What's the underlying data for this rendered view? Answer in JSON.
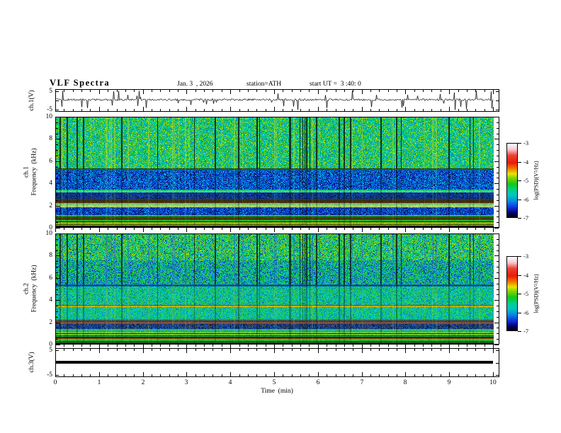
{
  "window": {
    "bg": "#ffffff",
    "fg": "#000000"
  },
  "header": {
    "title": "VLF Spectra",
    "date": "Jan. 3  , 2026",
    "station": "station=ATH",
    "start_ut": "start UT =  3 :40: 0"
  },
  "axes": {
    "time": {
      "label": "Time  (min)",
      "min": 0,
      "max": 10,
      "major_tick_labels": [
        "0",
        "1",
        "2",
        "3",
        "4",
        "5",
        "6",
        "7",
        "8",
        "9",
        "10"
      ],
      "minor_step_min": 0.2
    },
    "frequency": {
      "tick_labels": [
        "0",
        "2",
        "4",
        "6",
        "8",
        "10"
      ],
      "tick_values": [
        0,
        2,
        4,
        6,
        8,
        10
      ],
      "minor_step_khz": 0.5,
      "unit": "kHz"
    },
    "voltage": {
      "tick_labels": [
        "5",
        "-5"
      ],
      "tick_values": [
        5,
        -5
      ],
      "unit": "V"
    }
  },
  "panels": [
    {
      "id": "ch1_wave",
      "ylabel": "ch.1(V)",
      "ymin": -5,
      "ymax": 5
    },
    {
      "id": "ch1_spec",
      "ylabel_l1": "ch.1",
      "ylabel_l2": "Frequency  (kHz)",
      "ymin": 0,
      "ymax": 10
    },
    {
      "id": "ch2_spec",
      "ylabel_l1": "ch.2",
      "ylabel_l2": "Frequency  (kHz)",
      "ymin": 0,
      "ymax": 10
    },
    {
      "id": "ch3_wave",
      "ylabel": "ch.3(V)",
      "ymin": -5,
      "ymax": 5
    }
  ],
  "colorbar": {
    "label": "log(PSD)(V²/Hz)",
    "tick_labels": [
      "-3",
      "-4",
      "-5",
      "-6",
      "-7"
    ],
    "zmax": -3,
    "zmin": -7,
    "gradient": [
      [
        "#ffffff",
        0
      ],
      [
        "#f6c6d2",
        8
      ],
      [
        "#ee4030",
        16
      ],
      [
        "#e81a0c",
        26
      ],
      [
        "#f07800",
        34
      ],
      [
        "#e8e400",
        41
      ],
      [
        "#7cd400",
        47
      ],
      [
        "#12c818",
        55
      ],
      [
        "#00d088",
        63
      ],
      [
        "#00c4c4",
        70
      ],
      [
        "#0090e0",
        78
      ],
      [
        "#1238e0",
        86
      ],
      [
        "#000078",
        94
      ],
      [
        "#000000",
        100
      ]
    ]
  },
  "render": {
    "seed": 20260103,
    "streaks": {
      "dark_fraction": 0.045,
      "bright_fraction": 0.05
    }
  },
  "chart_data": [
    {
      "type": "line",
      "name": "ch.1 voltage waveform",
      "xlim": [
        0,
        10
      ],
      "xlabel": "Time (min)",
      "ylim": [
        -5,
        5
      ],
      "ylabel": "ch.1(V)",
      "summary": {
        "baseline_v": 0.4,
        "noise_peak_to_peak_v": 1.0,
        "impulsive_spikes": {
          "approx_count": 45,
          "amplitude_v_range": [
            1.5,
            5
          ],
          "polarity": "both, mostly negative",
          "clipped_at": 5
        }
      }
    },
    {
      "type": "heatmap",
      "name": "ch.1 spectrogram",
      "xlim": [
        0,
        10
      ],
      "xlabel": "Time (min)",
      "ylim": [
        0,
        10
      ],
      "ylabel": "ch.1 Frequency (kHz)",
      "zlim": [
        -7,
        -3
      ],
      "zlabel": "log(PSD)(V²/Hz)",
      "vertical_streaks": "full-band impulsive streaks aligned with ch.1 spikes (dark and bright columns)",
      "bands": [
        {
          "f0": 0.0,
          "f1": 0.12,
          "log_psd": -7.0,
          "mode": "rows",
          "streak": 0.0,
          "palette": [
            [
              "#000006",
              1
            ]
          ]
        },
        {
          "f0": 0.12,
          "f1": 0.5,
          "log_psd": -4.9,
          "mode": "rows",
          "streak": 0.2,
          "palette": [
            [
              "#14b83c",
              3
            ],
            [
              "#b4d400",
              2
            ],
            [
              "#06280a",
              2
            ]
          ]
        },
        {
          "f0": 0.5,
          "f1": 0.72,
          "log_psd": -4.4,
          "mode": "rows",
          "streak": 0.2,
          "palette": [
            [
              "#9a3410",
              2
            ],
            [
              "#18b838",
              2
            ],
            [
              "#0a340a",
              1
            ]
          ]
        },
        {
          "f0": 0.72,
          "f1": 0.95,
          "log_psd": -4.2,
          "mode": "rows",
          "streak": 0.2,
          "palette": [
            [
              "#742608",
              3
            ],
            [
              "#526014",
              1
            ],
            [
              "#1c340a",
              2
            ]
          ]
        },
        {
          "f0": 0.95,
          "f1": 1.12,
          "log_psd": -5.0,
          "mode": "rows",
          "streak": 0.2,
          "palette": [
            [
              "#22c44c",
              2
            ],
            [
              "#8ccc24",
              1
            ]
          ]
        },
        {
          "f0": 1.12,
          "f1": 1.8,
          "log_psd": -6.4,
          "mode": "speckle",
          "streak": 0.5,
          "bright": "#30c8d8",
          "palette": [
            [
              "#0f32c4",
              5
            ],
            [
              "#0864dc",
              3
            ],
            [
              "#00acd4",
              1
            ],
            [
              "#061048",
              2
            ]
          ]
        },
        {
          "f0": 1.8,
          "f1": 2.2,
          "log_psd": -4.8,
          "mode": "rows",
          "streak": 0.25,
          "palette": [
            [
              "#9cc860",
              2
            ],
            [
              "#c4d890",
              1
            ],
            [
              "#2cb84c",
              2
            ]
          ]
        },
        {
          "f0": 2.2,
          "f1": 2.6,
          "log_psd": -4.3,
          "mode": "rows",
          "streak": 0.25,
          "palette": [
            [
              "#6e2410",
              3
            ],
            [
              "#3a3420",
              2
            ],
            [
              "#0e3c12",
              1
            ]
          ]
        },
        {
          "f0": 2.6,
          "f1": 3.15,
          "log_psd": -6.5,
          "mode": "speckle",
          "streak": 0.4,
          "bright": "#30c8d8",
          "palette": [
            [
              "#26365a",
              2
            ],
            [
              "#0f2ca8",
              3
            ],
            [
              "#0854bc",
              2
            ],
            [
              "#061c3c",
              2
            ]
          ]
        },
        {
          "f0": 3.15,
          "f1": 3.4,
          "log_psd": -5.4,
          "mode": "rows",
          "streak": 0.3,
          "palette": [
            [
              "#1ed492",
              2
            ],
            [
              "#3cdcbe",
              2
            ],
            [
              "#26bc44",
              1
            ]
          ]
        },
        {
          "f0": 3.4,
          "f1": 5.15,
          "log_psd": -6.3,
          "mode": "speckle",
          "streak": 0.5,
          "bright": "#30c8d8",
          "palette": [
            [
              "#0e34c8",
              4
            ],
            [
              "#086ede",
              3
            ],
            [
              "#00b4dc",
              2
            ],
            [
              "#071552",
              2
            ]
          ]
        },
        {
          "f0": 5.15,
          "f1": 5.38,
          "log_psd": -4.5,
          "mode": "rows",
          "streak": 0.3,
          "palette": [
            [
              "#66260e",
              2
            ],
            [
              "#24400e",
              2
            ],
            [
              "#0a5ca8",
              1
            ]
          ]
        },
        {
          "f0": 5.38,
          "f1": 10.0,
          "log_psd": -5.3,
          "mode": "speckle",
          "streak": 0.9,
          "palette": [
            [
              "#12bc5c",
              3
            ],
            [
              "#00cc9c",
              2
            ],
            [
              "#2ecc2e",
              2
            ],
            [
              "#a4dc00",
              2
            ],
            [
              "#00b4d4",
              2
            ],
            [
              "#0878cc",
              1
            ]
          ]
        }
      ]
    },
    {
      "type": "heatmap",
      "name": "ch.2 spectrogram",
      "xlim": [
        0,
        10
      ],
      "xlabel": "Time (min)",
      "ylim": [
        0,
        10
      ],
      "ylabel": "ch.2 Frequency (kHz)",
      "zlim": [
        -7,
        -3
      ],
      "zlabel": "log(PSD)(V²/Hz)",
      "vertical_streaks": "full-band impulsive streaks aligned with ch.1 spikes (dark and blue columns)",
      "bands": [
        {
          "f0": 0.0,
          "f1": 0.12,
          "log_psd": -7.0,
          "mode": "rows",
          "streak": 0.0,
          "palette": [
            [
              "#000006",
              1
            ]
          ]
        },
        {
          "f0": 0.12,
          "f1": 0.45,
          "log_psd": -4.7,
          "mode": "rows",
          "streak": 0.2,
          "palette": [
            [
              "#b4d800",
              2
            ],
            [
              "#2cc42c",
              3
            ],
            [
              "#06280a",
              2
            ]
          ]
        },
        {
          "f0": 0.45,
          "f1": 0.75,
          "log_psd": -4.8,
          "mode": "rows",
          "streak": 0.2,
          "palette": [
            [
              "#26bc40",
              3
            ],
            [
              "#0a300a",
              2
            ],
            [
              "#9c3c10",
              1
            ]
          ]
        },
        {
          "f0": 0.75,
          "f1": 1.05,
          "log_psd": -4.7,
          "mode": "rows",
          "streak": 0.2,
          "palette": [
            [
              "#b0d410",
              2
            ],
            [
              "#44c438",
              2
            ],
            [
              "#12400f",
              1
            ]
          ]
        },
        {
          "f0": 1.05,
          "f1": 1.38,
          "log_psd": -5.4,
          "mode": "speckle",
          "streak": 0.3,
          "palette": [
            [
              "#1cb4ac",
              2
            ],
            [
              "#28bc48",
              2
            ]
          ]
        },
        {
          "f0": 1.38,
          "f1": 1.78,
          "log_psd": -6.3,
          "mode": "speckle",
          "streak": 0.4,
          "bright": "#30c8d8",
          "palette": [
            [
              "#16308a",
              3
            ],
            [
              "#0a58bc",
              2
            ],
            [
              "#062040",
              2
            ],
            [
              "#54545e",
              2
            ]
          ]
        },
        {
          "f0": 1.78,
          "f1": 2.25,
          "log_psd": -4.6,
          "mode": "rows",
          "streak": 0.25,
          "palette": [
            [
              "#6a6a6a",
              3
            ],
            [
              "#7c401c",
              2
            ],
            [
              "#2c3828",
              2
            ],
            [
              "#1e9c40",
              1
            ]
          ]
        },
        {
          "f0": 2.25,
          "f1": 3.35,
          "log_psd": -5.5,
          "mode": "speckle",
          "streak": 0.35,
          "palette": [
            [
              "#16c476",
              3
            ],
            [
              "#00c4c4",
              3
            ],
            [
              "#26c438",
              2
            ],
            [
              "#0884d4",
              1
            ]
          ]
        },
        {
          "f0": 3.35,
          "f1": 3.58,
          "log_psd": -3.9,
          "mode": "rows",
          "streak": 0.3,
          "palette": [
            [
              "#e02e06",
              4
            ],
            [
              "#e87c1c",
              2
            ],
            [
              "#c8c400",
              1
            ]
          ]
        },
        {
          "f0": 3.58,
          "f1": 5.2,
          "log_psd": -5.5,
          "mode": "speckle",
          "streak": 0.35,
          "palette": [
            [
              "#16c476",
              3
            ],
            [
              "#00c0c0",
              3
            ],
            [
              "#2cc438",
              2
            ],
            [
              "#0874c4",
              1
            ]
          ]
        },
        {
          "f0": 5.2,
          "f1": 5.42,
          "log_psd": -4.5,
          "mode": "rows",
          "streak": 0.3,
          "palette": [
            [
              "#66280e",
              2
            ],
            [
              "#26400e",
              2
            ],
            [
              "#0864ac",
              1
            ]
          ]
        },
        {
          "f0": 5.42,
          "f1": 7.6,
          "log_psd": -5.4,
          "mode": "speckle",
          "streak": 0.8,
          "bright": "#2860d8",
          "palette": [
            [
              "#1cc454",
              3
            ],
            [
              "#00bcac",
              2
            ],
            [
              "#34c82e",
              2
            ],
            [
              "#0e3cc4",
              2
            ],
            [
              "#088cd8",
              2
            ]
          ]
        },
        {
          "f0": 7.6,
          "f1": 10.0,
          "log_psd": -5.2,
          "mode": "speckle",
          "streak": 0.85,
          "bright": "#2860d8",
          "palette": [
            [
              "#24c448",
              4
            ],
            [
              "#00c4a0",
              2
            ],
            [
              "#9cd400",
              2
            ],
            [
              "#0ea8d8",
              1
            ],
            [
              "#0e3cc0",
              1
            ]
          ]
        }
      ]
    },
    {
      "type": "line",
      "name": "ch.3 voltage waveform",
      "xlim": [
        0,
        10
      ],
      "xlabel": "Time (min)",
      "ylim": [
        -5,
        5
      ],
      "ylabel": "ch.3(V)",
      "summary": {
        "constant_v": 0,
        "appearance": "thick flat black trace at 0 V"
      }
    }
  ]
}
